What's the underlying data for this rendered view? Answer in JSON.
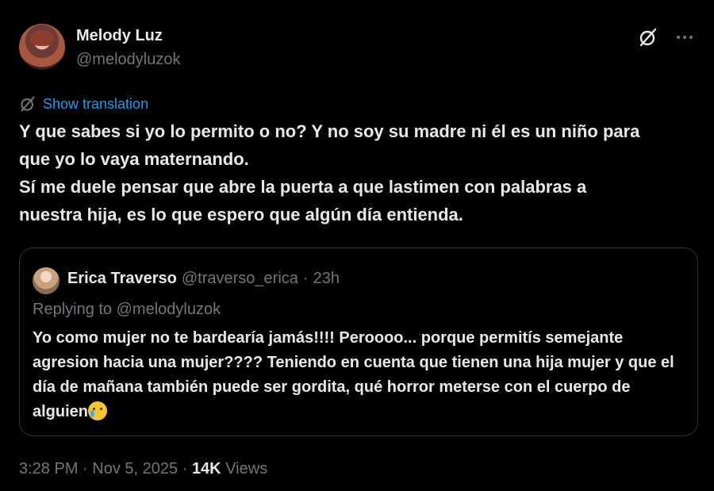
{
  "author": {
    "name": "Melody Luz",
    "handle": "@melodyluzok"
  },
  "icons": {
    "grok": "grok-icon",
    "more": "more-horizontal-icon",
    "translate": "grok-icon"
  },
  "translation_link": "Show translation",
  "tweet_text": "Y que sabes si yo lo permito o no? Y no soy su madre ni él es un niño para\nque yo lo vaya maternando.\nSí me duele pensar que abre la puerta a que lastimen con palabras a\nnuestra hija, es lo que espero que algún día entienda.",
  "quote": {
    "name": "Erica Traverso",
    "handle": "@traverso_erica",
    "separator": "·",
    "age": "23h",
    "replying_to": "Replying to @melodyluzok",
    "text": "Yo como mujer no te bardearía jamás!!!! Peroooo... porque permitís semejante agresion hacia una mujer???? Teniendo en cuenta que tienen una hija mujer y que el día de mañana también puede ser gordita, qué horror meterse con el cuerpo de alguien",
    "emoji": "crying-face-emoji"
  },
  "footer": {
    "time": "3:28 PM",
    "date": "Nov 5, 2025",
    "separator": "·",
    "views_count": "14K",
    "views_label": "Views"
  },
  "colors": {
    "background": "#000000",
    "text": "#e7e9ea",
    "muted": "#71767b",
    "link": "#1d9bf0",
    "border": "#2f3336"
  }
}
